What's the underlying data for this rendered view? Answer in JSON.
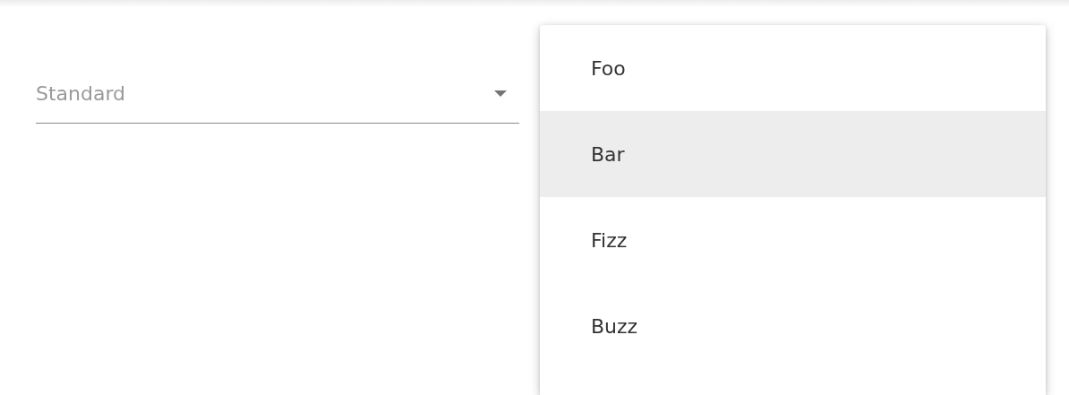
{
  "select": {
    "placeholder": "Standard"
  },
  "menu": {
    "items": [
      {
        "label": "Foo",
        "selected": false
      },
      {
        "label": "Bar",
        "selected": true
      },
      {
        "label": "Fizz",
        "selected": false
      },
      {
        "label": "Buzz",
        "selected": false
      }
    ]
  }
}
